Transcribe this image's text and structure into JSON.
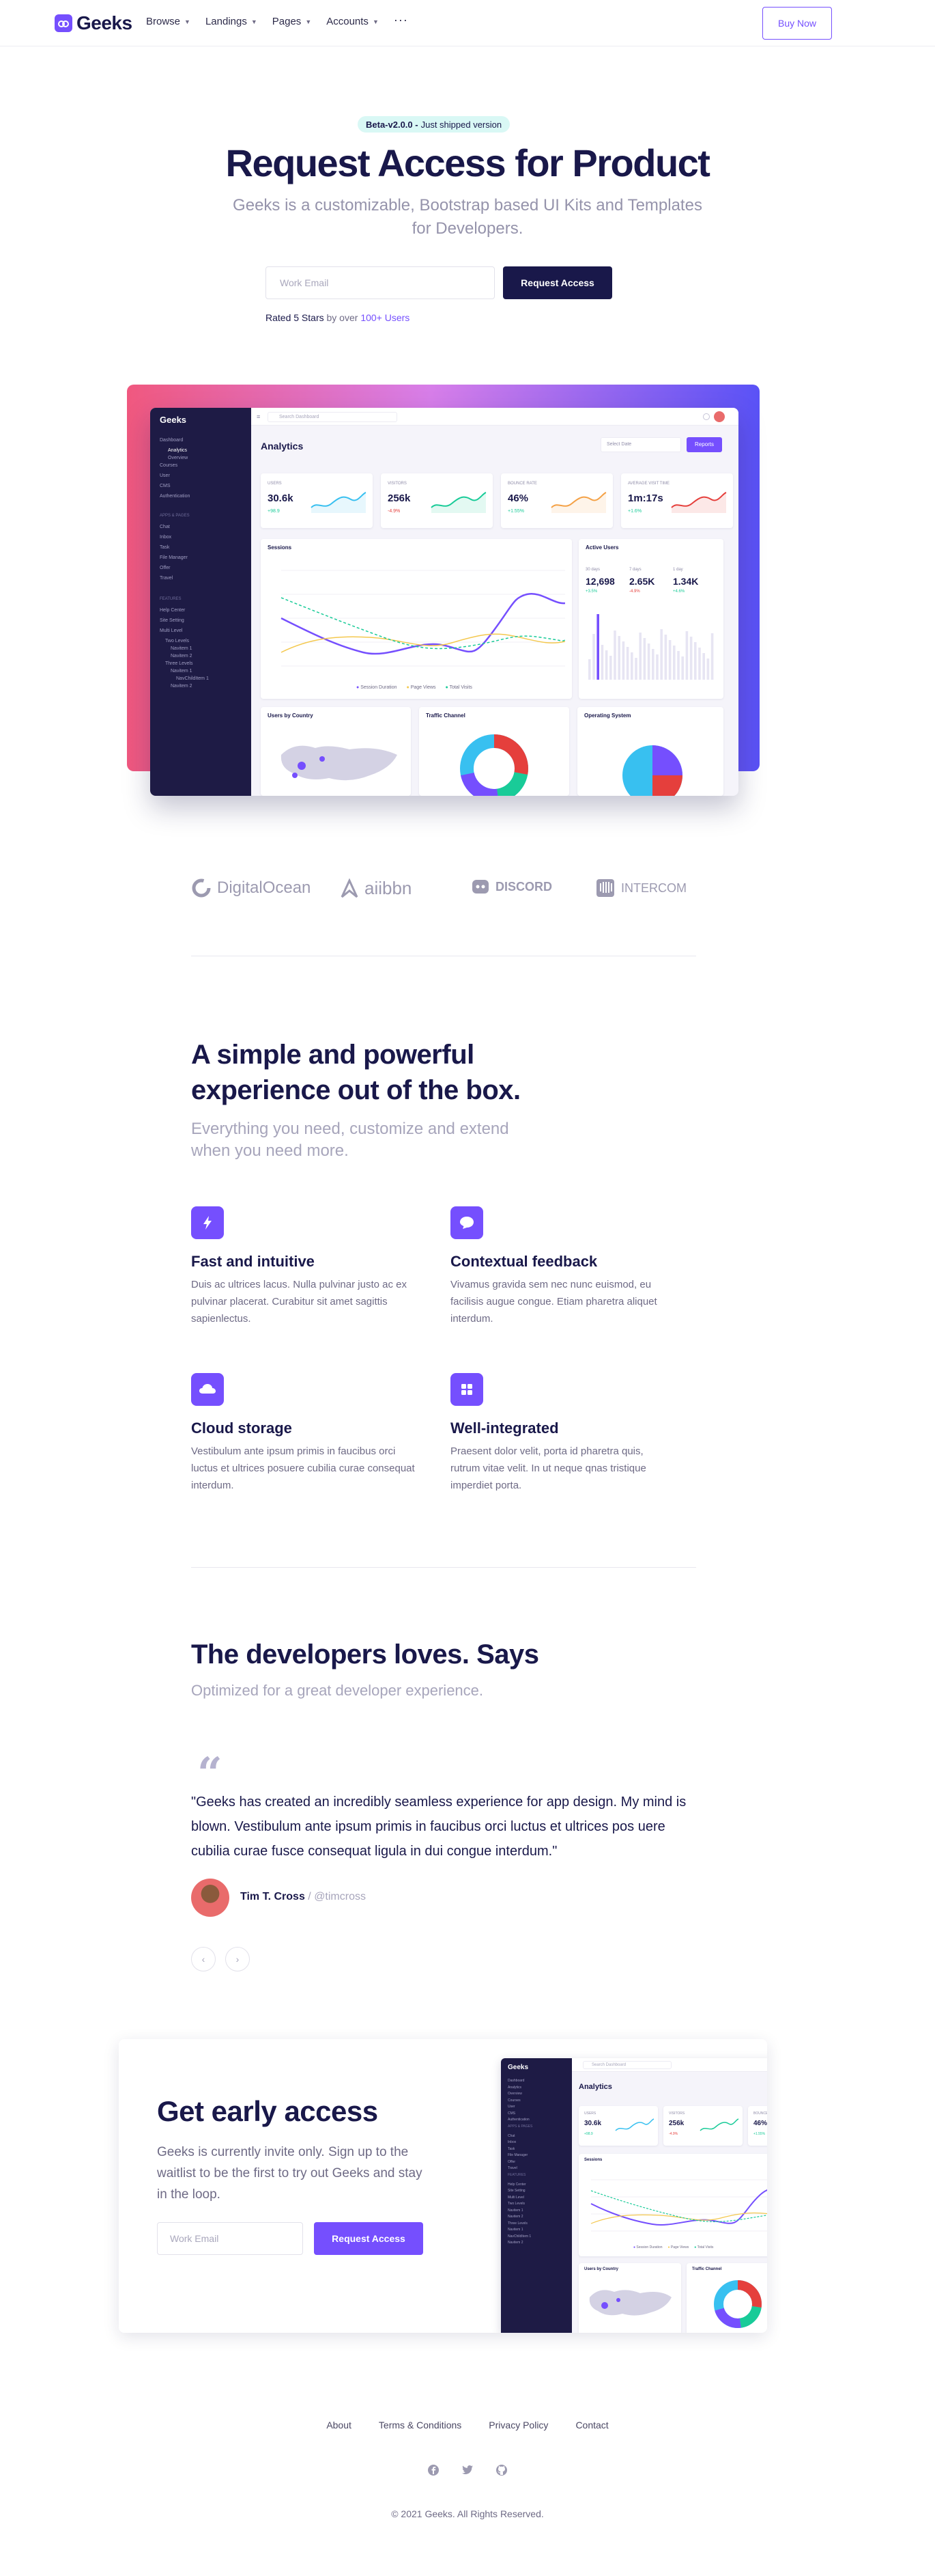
{
  "brand": {
    "name": "Geeks",
    "accent": "#754ffe",
    "dark": "#19184a"
  },
  "nav": {
    "items": [
      "Browse",
      "Landings",
      "Pages",
      "Accounts"
    ],
    "more": "···",
    "cta": "Buy Now"
  },
  "hero": {
    "badge_strong": "Beta-v2.0.0 -",
    "badge_text": "Just shipped version",
    "title": "Request Access for Product",
    "subtitle": "Geeks is a customizable, Bootstrap based UI Kits and Templates for Developers.",
    "email_placeholder": "Work Email",
    "button": "Request Access",
    "rated_prefix": "Rated 5 Stars",
    "rated_mid": " by over ",
    "rated_link": "100+ Users"
  },
  "dashboard": {
    "logo": "Geeks",
    "search_placeholder": "Search Dashboard",
    "title": "Analytics",
    "date_placeholder": "Select Date",
    "reports_button": "Reports",
    "sidebar": {
      "main": [
        "Dashboard",
        "Analytics",
        "Overview",
        "Courses",
        "User",
        "CMS",
        "Authentication"
      ],
      "apps_heading": "APPS & PAGES",
      "apps": [
        "Chat",
        "Inbox",
        "Task",
        "File Manager",
        "Offer",
        "Travel"
      ],
      "features_heading": "FEATURES",
      "features": [
        "Help Center",
        "Site Setting",
        "Multi Level",
        "Two Levels",
        "Navitem 1",
        "Navitem 2",
        "Three Levels",
        "Navitem 1",
        "NavChildItem 1",
        "Navitem 2"
      ]
    },
    "stats": [
      {
        "label": "USERS",
        "value": "30.6k",
        "change": "+98.9",
        "dir": "up",
        "color": "#38c0f0"
      },
      {
        "label": "VISITORS",
        "value": "256k",
        "change": "-4.9%",
        "dir": "down",
        "color": "#19cb98"
      },
      {
        "label": "BOUNCE RATE",
        "value": "46%",
        "change": "+1.55%",
        "dir": "up",
        "color": "#f4a146"
      },
      {
        "label": "AVERAGE VISIT TIME",
        "value": "1m:17s",
        "change": "+1.6%",
        "dir": "up",
        "color": "#e53f3c"
      }
    ],
    "sessions_title": "Sessions",
    "sessions_legend": [
      "Session Duration",
      "Page Views",
      "Total Visits"
    ],
    "active_title": "Active Users",
    "active_stats": [
      {
        "label": "30 days",
        "value": "12,698",
        "change": "+3.5%"
      },
      {
        "label": "7 days",
        "value": "2.65K",
        "change": "-4.9%"
      },
      {
        "label": "1 day",
        "value": "1.34K",
        "change": "+4.6%"
      }
    ],
    "bottom_cards": [
      "Users by Country",
      "Traffic Channel",
      "Operating System"
    ]
  },
  "logos": [
    "DigitalOcean",
    "aiibbn",
    "DISCORD",
    "INTERCOM"
  ],
  "features": {
    "title": "A simple and powerful experience out of the box.",
    "subtitle": "Everything you need, customize and extend when you need more.",
    "items": [
      {
        "icon": "bolt-icon",
        "title": "Fast and intuitive",
        "text": "Duis ac ultrices lacus. Nulla pulvinar justo ac ex pulvinar placerat. Curabitur sit amet sagittis sapienlectus."
      },
      {
        "icon": "chat-bubble-icon",
        "title": "Contextual feedback",
        "text": "Vivamus gravida sem nec nunc euismod, eu facilisis augue congue. Etiam pharetra aliquet interdum."
      },
      {
        "icon": "cloud-icon",
        "title": "Cloud storage",
        "text": "Vestibulum ante ipsum primis in faucibus orci luctus et ultrices posuere cubilia curae consequat interdum."
      },
      {
        "icon": "grid-icon",
        "title": "Well-integrated",
        "text": "Praesent dolor velit, porta id pharetra quis, rutrum vitae velit. In ut neque qnas tristique imperdiet porta."
      }
    ]
  },
  "testimonials": {
    "title": "The developers loves. Says",
    "subtitle": "Optimized for a great developer experience.",
    "quote": "\"Geeks has created an incredibly seamless experience for app design. My mind is blown. Vestibulum ante ipsum primis in faucibus orci luctus et ultrices pos uere cubilia curae fusce consequat ligula in dui congue interdum.\"",
    "author": "Tim T. Cross",
    "handle": "@timcross"
  },
  "early_access": {
    "title": "Get early access",
    "text": "Geeks is currently invite only. Sign up to the waitlist to be the first to try out Geeks and stay in the loop.",
    "email_placeholder": "Work Email",
    "button": "Request Access"
  },
  "footer": {
    "links": [
      "About",
      "Terms & Conditions",
      "Privacy Policy",
      "Contact"
    ],
    "social_icons": [
      "facebook-icon",
      "twitter-icon",
      "github-icon"
    ],
    "copyright": "© 2021 Geeks. All Rights Reserved."
  }
}
